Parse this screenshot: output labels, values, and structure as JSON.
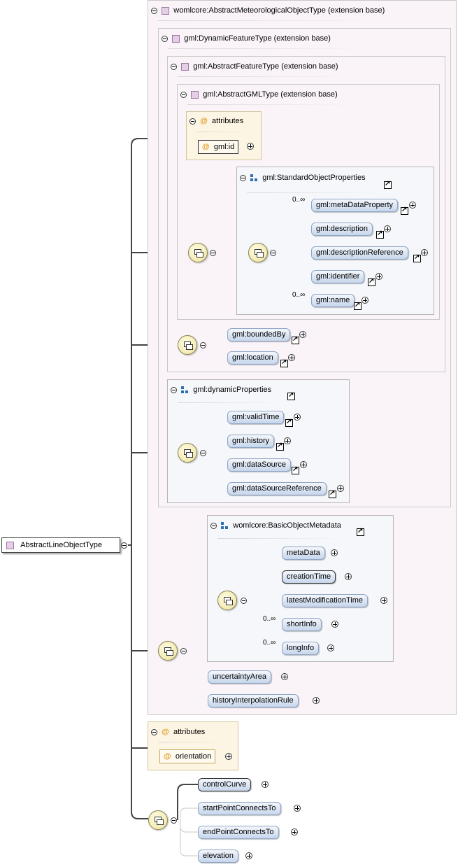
{
  "root": {
    "label": "AbstractLineObjectType"
  },
  "base_types": {
    "meteorological": "womlcore:AbstractMeteorologicalObjectType (extension base)",
    "dynamic_feature": "gml:DynamicFeatureType (extension base)",
    "feature": "gml:AbstractFeatureType (extension base)",
    "gml": "gml:AbstractGMLType (extension base)"
  },
  "attributes_label": "attributes",
  "gml_attributes": [
    "gml:id"
  ],
  "standard_object_properties": {
    "title": "gml:StandardObjectProperties",
    "items": [
      {
        "name": "gml:metaDataProperty",
        "multiplicity": "0..∞"
      },
      {
        "name": "gml:description",
        "multiplicity": ""
      },
      {
        "name": "gml:descriptionReference",
        "multiplicity": ""
      },
      {
        "name": "gml:identifier",
        "multiplicity": ""
      },
      {
        "name": "gml:name",
        "multiplicity": "0..∞"
      }
    ]
  },
  "feature_elements": [
    "gml:boundedBy",
    "gml:location"
  ],
  "dynamic_properties": {
    "title": "gml:dynamicProperties",
    "items": [
      "gml:validTime",
      "gml:history",
      "gml:dataSource",
      "gml:dataSourceReference"
    ]
  },
  "basic_object_metadata": {
    "title": "womlcore:BasicObjectMetadata",
    "items": [
      {
        "name": "metaData",
        "multiplicity": ""
      },
      {
        "name": "creationTime",
        "multiplicity": ""
      },
      {
        "name": "latestModificationTime",
        "multiplicity": ""
      },
      {
        "name": "shortInfo",
        "multiplicity": "0..∞"
      },
      {
        "name": "longInfo",
        "multiplicity": "0..∞"
      }
    ]
  },
  "meteorological_elements": [
    "uncertaintyArea",
    "historyInterpolationRule"
  ],
  "line_attributes": [
    "orientation"
  ],
  "line_elements": [
    "controlCurve",
    "startPointConnectsTo",
    "endPointConnectsTo",
    "elevation"
  ],
  "icons": {
    "type": "complex-type-icon",
    "group": "model-group-icon",
    "attribute": "attribute-at-icon",
    "sequence": "sequence-compositor-icon",
    "collapse": "collapse-minus-icon",
    "expand": "expand-plus-icon",
    "reference": "reference-arrow-icon"
  },
  "colors": {
    "element_fill": "#c6d6ec",
    "type_box_fill": "#faf4f9",
    "attribute_fill": "#fdf5e3",
    "compositor_fill": "#f3ecb8"
  }
}
